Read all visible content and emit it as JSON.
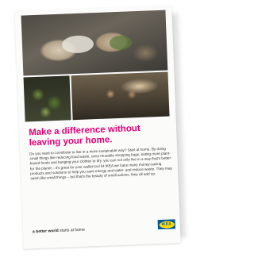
{
  "poster": {
    "headline": "Make a difference without leaving your home.",
    "body": "Do you want to contribute to live in a more sustainable way? Start at home. By doing small things like reducing food waste, carry reusable shopping bags, eating more plant-based foods and hanging your clothes to dry, you can not only live in a way that's better for the planet – it's great for your wallet too! At IKEA we have many money-saving products and solutions to help you save energy and water, and reduce waste. They may seem like small things – but that's the beauty of small actions, they all add up.",
    "tagline_bold": "a better world",
    "tagline_rest": " starts at home",
    "logo_text": "IKEA",
    "colors": {
      "headline": "#e2007a",
      "logo_blue": "#0058a3",
      "logo_yellow": "#ffdb00"
    }
  }
}
